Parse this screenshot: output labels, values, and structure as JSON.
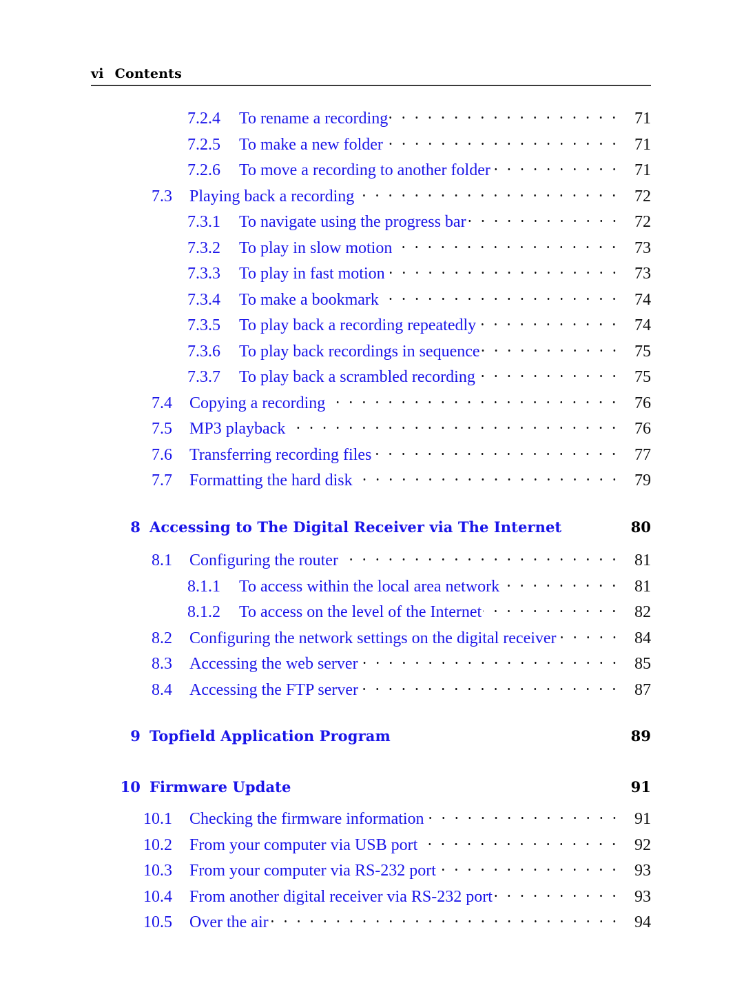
{
  "page": {
    "folio": "vi",
    "running_head": "Contents",
    "background_color": "#ffffff",
    "accent_color": "#1a15e8",
    "rule_color": "#3a3a3a"
  },
  "toc": {
    "entries": [
      {
        "level": 3,
        "number": "7.2.4",
        "title": "To rename a recording",
        "page": "71",
        "leader": true
      },
      {
        "level": 3,
        "number": "7.2.5",
        "title": "To make a new folder",
        "page": "71",
        "leader": true
      },
      {
        "level": 3,
        "number": "7.2.6",
        "title": "To move a recording to another folder",
        "page": "71",
        "leader": true
      },
      {
        "level": 2,
        "number": "7.3",
        "title": "Playing back a recording",
        "page": "72",
        "leader": true
      },
      {
        "level": 3,
        "number": "7.3.1",
        "title": "To navigate using the progress bar",
        "page": "72",
        "leader": true
      },
      {
        "level": 3,
        "number": "7.3.2",
        "title": "To play in slow motion",
        "page": "73",
        "leader": true
      },
      {
        "level": 3,
        "number": "7.3.3",
        "title": "To play in fast motion",
        "page": "73",
        "leader": true
      },
      {
        "level": 3,
        "number": "7.3.4",
        "title": "To make a bookmark",
        "page": "74",
        "leader": true
      },
      {
        "level": 3,
        "number": "7.3.5",
        "title": "To play back a recording repeatedly",
        "page": "74",
        "leader": true
      },
      {
        "level": 3,
        "number": "7.3.6",
        "title": "To play back recordings in sequence",
        "page": "75",
        "leader": true
      },
      {
        "level": 3,
        "number": "7.3.7",
        "title": "To play back a scrambled recording",
        "page": "75",
        "leader": true
      },
      {
        "level": 2,
        "number": "7.4",
        "title": "Copying a recording",
        "page": "76",
        "leader": true
      },
      {
        "level": 2,
        "number": "7.5",
        "title": "MP3 playback",
        "page": "76",
        "leader": true
      },
      {
        "level": 2,
        "number": "7.6",
        "title": "Transferring recording files",
        "page": "77",
        "leader": true
      },
      {
        "level": 2,
        "number": "7.7",
        "title": "Formatting the hard disk",
        "page": "79",
        "leader": true
      },
      {
        "level": 1,
        "number": "8",
        "title": "Accessing to The Digital Receiver via The Internet",
        "page": "80",
        "leader": false
      },
      {
        "level": 2,
        "number": "8.1",
        "title": "Configuring the router",
        "page": "81",
        "leader": true
      },
      {
        "level": 3,
        "number": "8.1.1",
        "title": "To access within the local area network",
        "page": "81",
        "leader": true
      },
      {
        "level": 3,
        "number": "8.1.2",
        "title": "To access on the level of the Internet",
        "page": "82",
        "leader": true
      },
      {
        "level": 2,
        "number": "8.2",
        "title": "Configuring the network settings on the digital receiver",
        "page": "84",
        "leader": true
      },
      {
        "level": 2,
        "number": "8.3",
        "title": "Accessing the web server",
        "page": "85",
        "leader": true
      },
      {
        "level": 2,
        "number": "8.4",
        "title": "Accessing the FTP server",
        "page": "87",
        "leader": true
      },
      {
        "level": 1,
        "number": "9",
        "title": "Topfield Application Program",
        "page": "89",
        "leader": false
      },
      {
        "level": 1,
        "number": "10",
        "title": "Firmware Update",
        "page": "91",
        "leader": false
      },
      {
        "level": 2,
        "number": "10.1",
        "title": "Checking the firmware information",
        "page": "91",
        "leader": true
      },
      {
        "level": 2,
        "number": "10.2",
        "title": "From your computer via USB port",
        "page": "92",
        "leader": true
      },
      {
        "level": 2,
        "number": "10.3",
        "title": "From your computer via RS-232 port",
        "page": "93",
        "leader": true
      },
      {
        "level": 2,
        "number": "10.4",
        "title": "From another digital receiver via RS-232 port",
        "page": "93",
        "leader": true
      },
      {
        "level": 2,
        "number": "10.5",
        "title": "Over the air",
        "page": "94",
        "leader": true
      }
    ]
  }
}
